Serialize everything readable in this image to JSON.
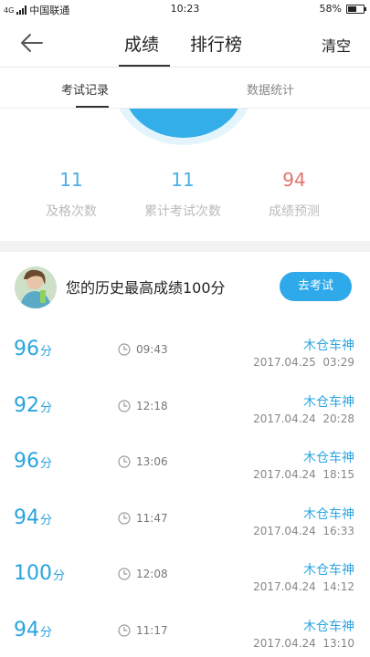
{
  "status": {
    "network": "4G",
    "carrier": "中国联通",
    "time": "10:23",
    "battery": "58%",
    "battery_level": 0.58
  },
  "nav": {
    "tab_score": "成绩",
    "tab_rank": "排行榜",
    "clear": "清空"
  },
  "subtabs": {
    "records": "考试记录",
    "statistics": "数据统计"
  },
  "colors": {
    "accent": "#2eaaea",
    "score": "#2aa4e0",
    "prediction": "#e0766d"
  },
  "stats": {
    "pass_value": "11",
    "pass_label": "及格次数",
    "total_value": "11",
    "total_label": "累计考试次数",
    "predict_value": "94",
    "predict_label": "成绩预测"
  },
  "best": {
    "text": "您的历史最高成绩100分",
    "button": "去考试"
  },
  "records": [
    {
      "score": "96",
      "unit": "分",
      "duration": "09:43",
      "name": "木仓车神",
      "date": "2017.04.25  03:29"
    },
    {
      "score": "92",
      "unit": "分",
      "duration": "12:18",
      "name": "木仓车神",
      "date": "2017.04.24  20:28"
    },
    {
      "score": "96",
      "unit": "分",
      "duration": "13:06",
      "name": "木仓车神",
      "date": "2017.04.24  18:15"
    },
    {
      "score": "94",
      "unit": "分",
      "duration": "11:47",
      "name": "木仓车神",
      "date": "2017.04.24  16:33"
    },
    {
      "score": "100",
      "unit": "分",
      "duration": "12:08",
      "name": "木仓车神",
      "date": "2017.04.24  14:12"
    },
    {
      "score": "94",
      "unit": "分",
      "duration": "11:17",
      "name": "木仓车神",
      "date": "2017.04.24  13:10"
    }
  ]
}
